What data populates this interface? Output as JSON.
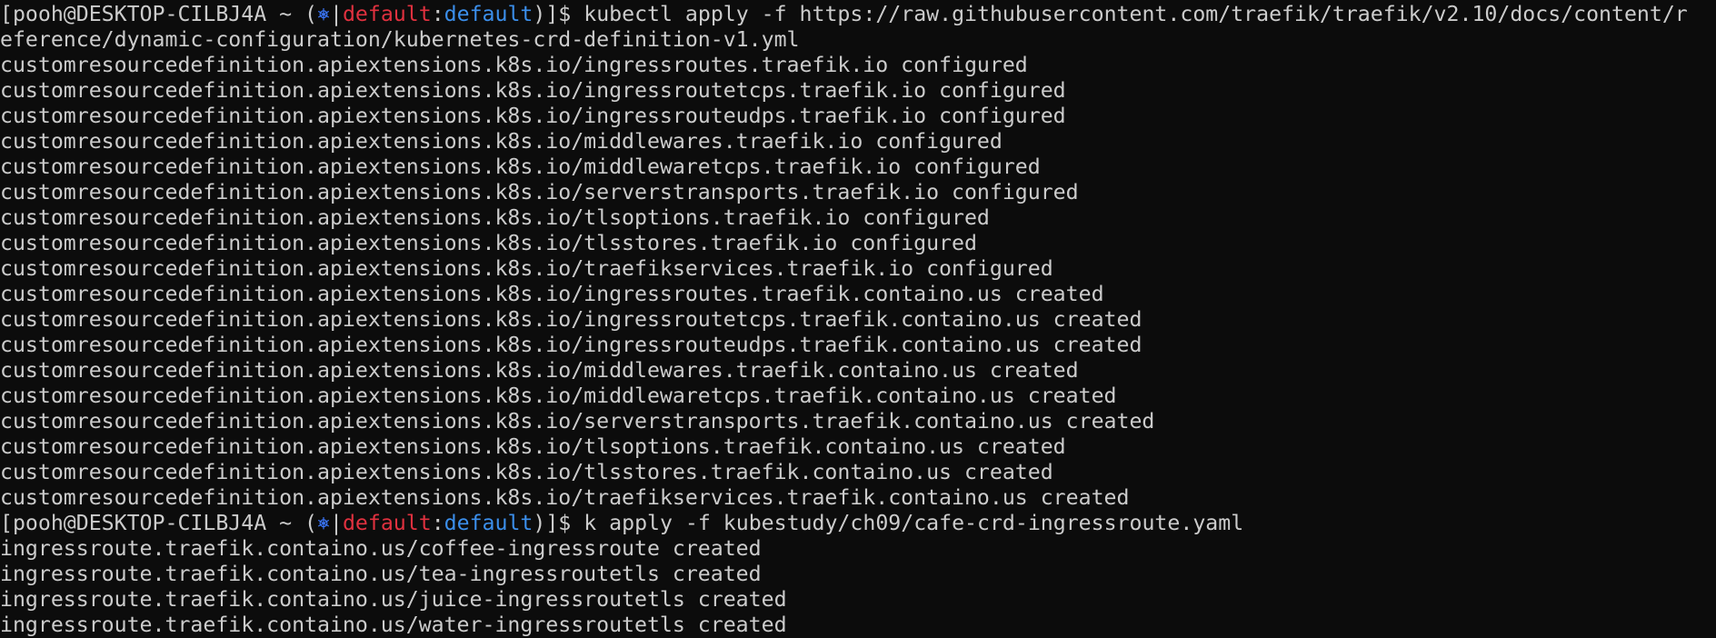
{
  "colors": {
    "background": "#0c0c0c",
    "foreground": "#cccccc",
    "context_red": "#e0313f",
    "namespace_blue": "#3b8eea",
    "k8s_icon": "#3b78ff"
  },
  "prompt": {
    "user_host": "[pooh@DESKTOP-CILBJ4A ~ (",
    "icon": "⎈",
    "bar": "|",
    "context": "default",
    "colon": ":",
    "namespace": "default",
    "suffix": ")]$ "
  },
  "commands": [
    {
      "text_line1": "kubectl apply -f https://raw.githubusercontent.com/traefik/traefik/v2.10/docs/content/r",
      "text_line2": "eference/dynamic-configuration/kubernetes-crd-definition-v1.yml",
      "output": [
        "customresourcedefinition.apiextensions.k8s.io/ingressroutes.traefik.io configured",
        "customresourcedefinition.apiextensions.k8s.io/ingressroutetcps.traefik.io configured",
        "customresourcedefinition.apiextensions.k8s.io/ingressrouteudps.traefik.io configured",
        "customresourcedefinition.apiextensions.k8s.io/middlewares.traefik.io configured",
        "customresourcedefinition.apiextensions.k8s.io/middlewaretcps.traefik.io configured",
        "customresourcedefinition.apiextensions.k8s.io/serverstransports.traefik.io configured",
        "customresourcedefinition.apiextensions.k8s.io/tlsoptions.traefik.io configured",
        "customresourcedefinition.apiextensions.k8s.io/tlsstores.traefik.io configured",
        "customresourcedefinition.apiextensions.k8s.io/traefikservices.traefik.io configured",
        "customresourcedefinition.apiextensions.k8s.io/ingressroutes.traefik.containo.us created",
        "customresourcedefinition.apiextensions.k8s.io/ingressroutetcps.traefik.containo.us created",
        "customresourcedefinition.apiextensions.k8s.io/ingressrouteudps.traefik.containo.us created",
        "customresourcedefinition.apiextensions.k8s.io/middlewares.traefik.containo.us created",
        "customresourcedefinition.apiextensions.k8s.io/middlewaretcps.traefik.containo.us created",
        "customresourcedefinition.apiextensions.k8s.io/serverstransports.traefik.containo.us created",
        "customresourcedefinition.apiextensions.k8s.io/tlsoptions.traefik.containo.us created",
        "customresourcedefinition.apiextensions.k8s.io/tlsstores.traefik.containo.us created",
        "customresourcedefinition.apiextensions.k8s.io/traefikservices.traefik.containo.us created"
      ]
    },
    {
      "text_line1": "k apply -f kubestudy/ch09/cafe-crd-ingressroute.yaml",
      "output": [
        "ingressroute.traefik.containo.us/coffee-ingressroute created",
        "ingressroute.traefik.containo.us/tea-ingressroutetls created",
        "ingressroute.traefik.containo.us/juice-ingressroutetls created",
        "ingressroute.traefik.containo.us/water-ingressroutetls created"
      ]
    }
  ]
}
